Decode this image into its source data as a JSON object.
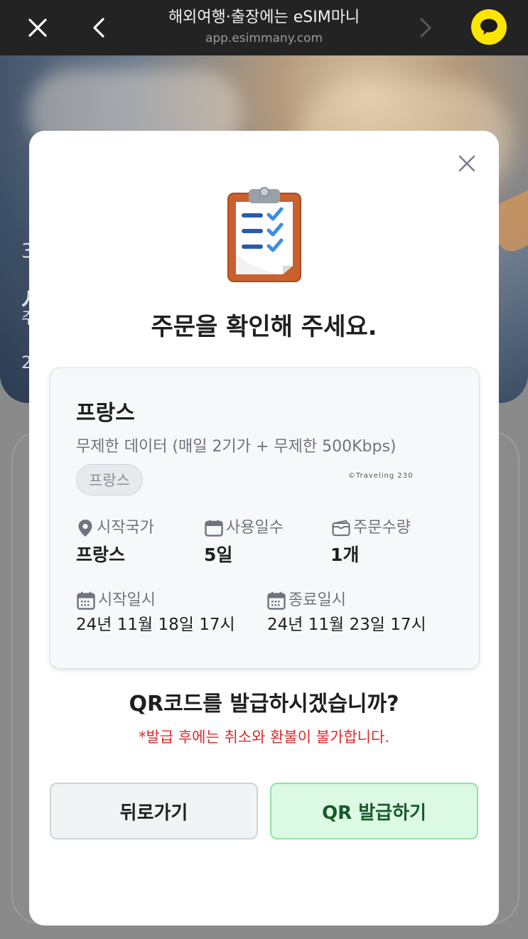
{
  "browser": {
    "title": "해외여행·출장에는 eSIM마니",
    "url": "app.esimmany.com"
  },
  "background": {
    "fragments": [
      "3",
      "사",
      "주",
      "2"
    ]
  },
  "modal": {
    "title": "주문을 확인해 주세요.",
    "order": {
      "country": "프랑스",
      "plan": "무제한 데이터 (매일 2기가 + 무제한 500Kbps)",
      "tag": "프랑스",
      "watermark": "©Traveling 230",
      "start_country_label": "시작국가",
      "start_country_value": "프랑스",
      "days_label": "사용일수",
      "days_value": "5일",
      "quantity_label": "주문수량",
      "quantity_value": "1개",
      "start_date_label": "시작일시",
      "start_date_value": "24년 11월 18일 17시",
      "end_date_label": "종료일시",
      "end_date_value": "24년 11월 23일 17시"
    },
    "question": "QR코드를 발급하시겠습니까?",
    "warning": "*발급 후에는 취소와 환불이 불가합니다.",
    "back_button": "뒤로가기",
    "issue_button": "QR 발급하기"
  },
  "icons": {
    "close": "close-icon",
    "back": "chevron-left-icon",
    "forward": "chevron-right-icon",
    "kakao": "kakao-chat-icon",
    "clipboard": "clipboard-icon",
    "location": "location-pin-icon",
    "calendar": "calendar-icon",
    "wallet": "wallet-icon"
  },
  "colors": {
    "warning": "#d92b2b",
    "issue_button_bg": "#dcf9e3",
    "issue_button_border": "#8fe3a6",
    "kakao": "#fee500"
  }
}
